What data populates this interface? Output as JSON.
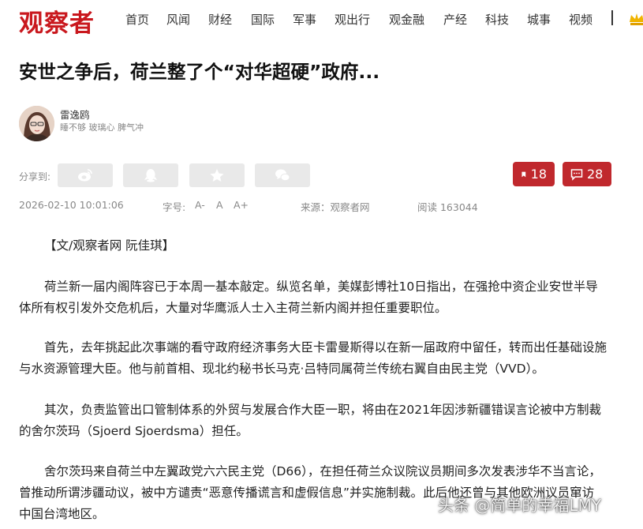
{
  "site": {
    "logo": "观察者",
    "nav": [
      "首页",
      "风闻",
      "财经",
      "国际",
      "军事",
      "观出行",
      "观金融",
      "产经",
      "科技",
      "城事",
      "视频"
    ]
  },
  "article": {
    "title": "安世之争后，荷兰整了个“对华超硬”政府...",
    "author": {
      "name": "雷逸鸥",
      "bio": "睡不够 玻璃心 脾气冲"
    },
    "share_label": "分享到:",
    "share_icons": [
      "weibo-icon",
      "qq-icon",
      "qzone-icon",
      "wechat-icon"
    ],
    "bookmark_count": "18",
    "comment_count": "28",
    "meta": {
      "datetime": "2026-02-10 10:01:06",
      "font_label": "字号:",
      "font_sizes": [
        "A-",
        "A",
        "A+"
      ],
      "source": "来源：观察者网",
      "views": "阅读 163044"
    },
    "paragraphs": [
      [
        "【文/观察者网 阮佳琪】"
      ],
      [
        "荷兰新一届内阁阵容已于本周一基本敲定。纵览名单，美媒彭博社10日指出，在强抢中资企业安世半导",
        "体所有权引发外交危机后，大量对华鹰派人士入主荷兰新内阁并担任重要职位。"
      ],
      [
        "首先，去年挑起此次事端的看守政府经济事务大臣卡雷曼斯得以在新一届政府中留任，转而出任基础设施",
        "与水资源管理大臣。他与前首相、现北约秘书长马克·吕特同属荷兰传统右翼自由民主党（VVD）。"
      ],
      [
        "其次，负责监管出口管制体系的外贸与发展合作大臣一职，将由在2021年因涉新疆错误言论被中方制裁",
        "的舍尔茨玛（Sjoerd Sjoerdsma）担任。"
      ],
      [
        "舍尔茨玛来自荷兰中左翼政党六六民主党（D66），在担任荷兰众议院议员期间多次发表涉华不当言论，",
        "曾推动所谓涉疆动议，被中方谴责“恶意传播谎言和虚假信息”并实施制裁。此后他还曾与其他欧洲议员窜访",
        "中国台湾地区。"
      ]
    ]
  },
  "watermark": "头条 @简单的幸福LMY",
  "colors": {
    "brand": "#c9181e",
    "button_red": "#c0282d"
  }
}
